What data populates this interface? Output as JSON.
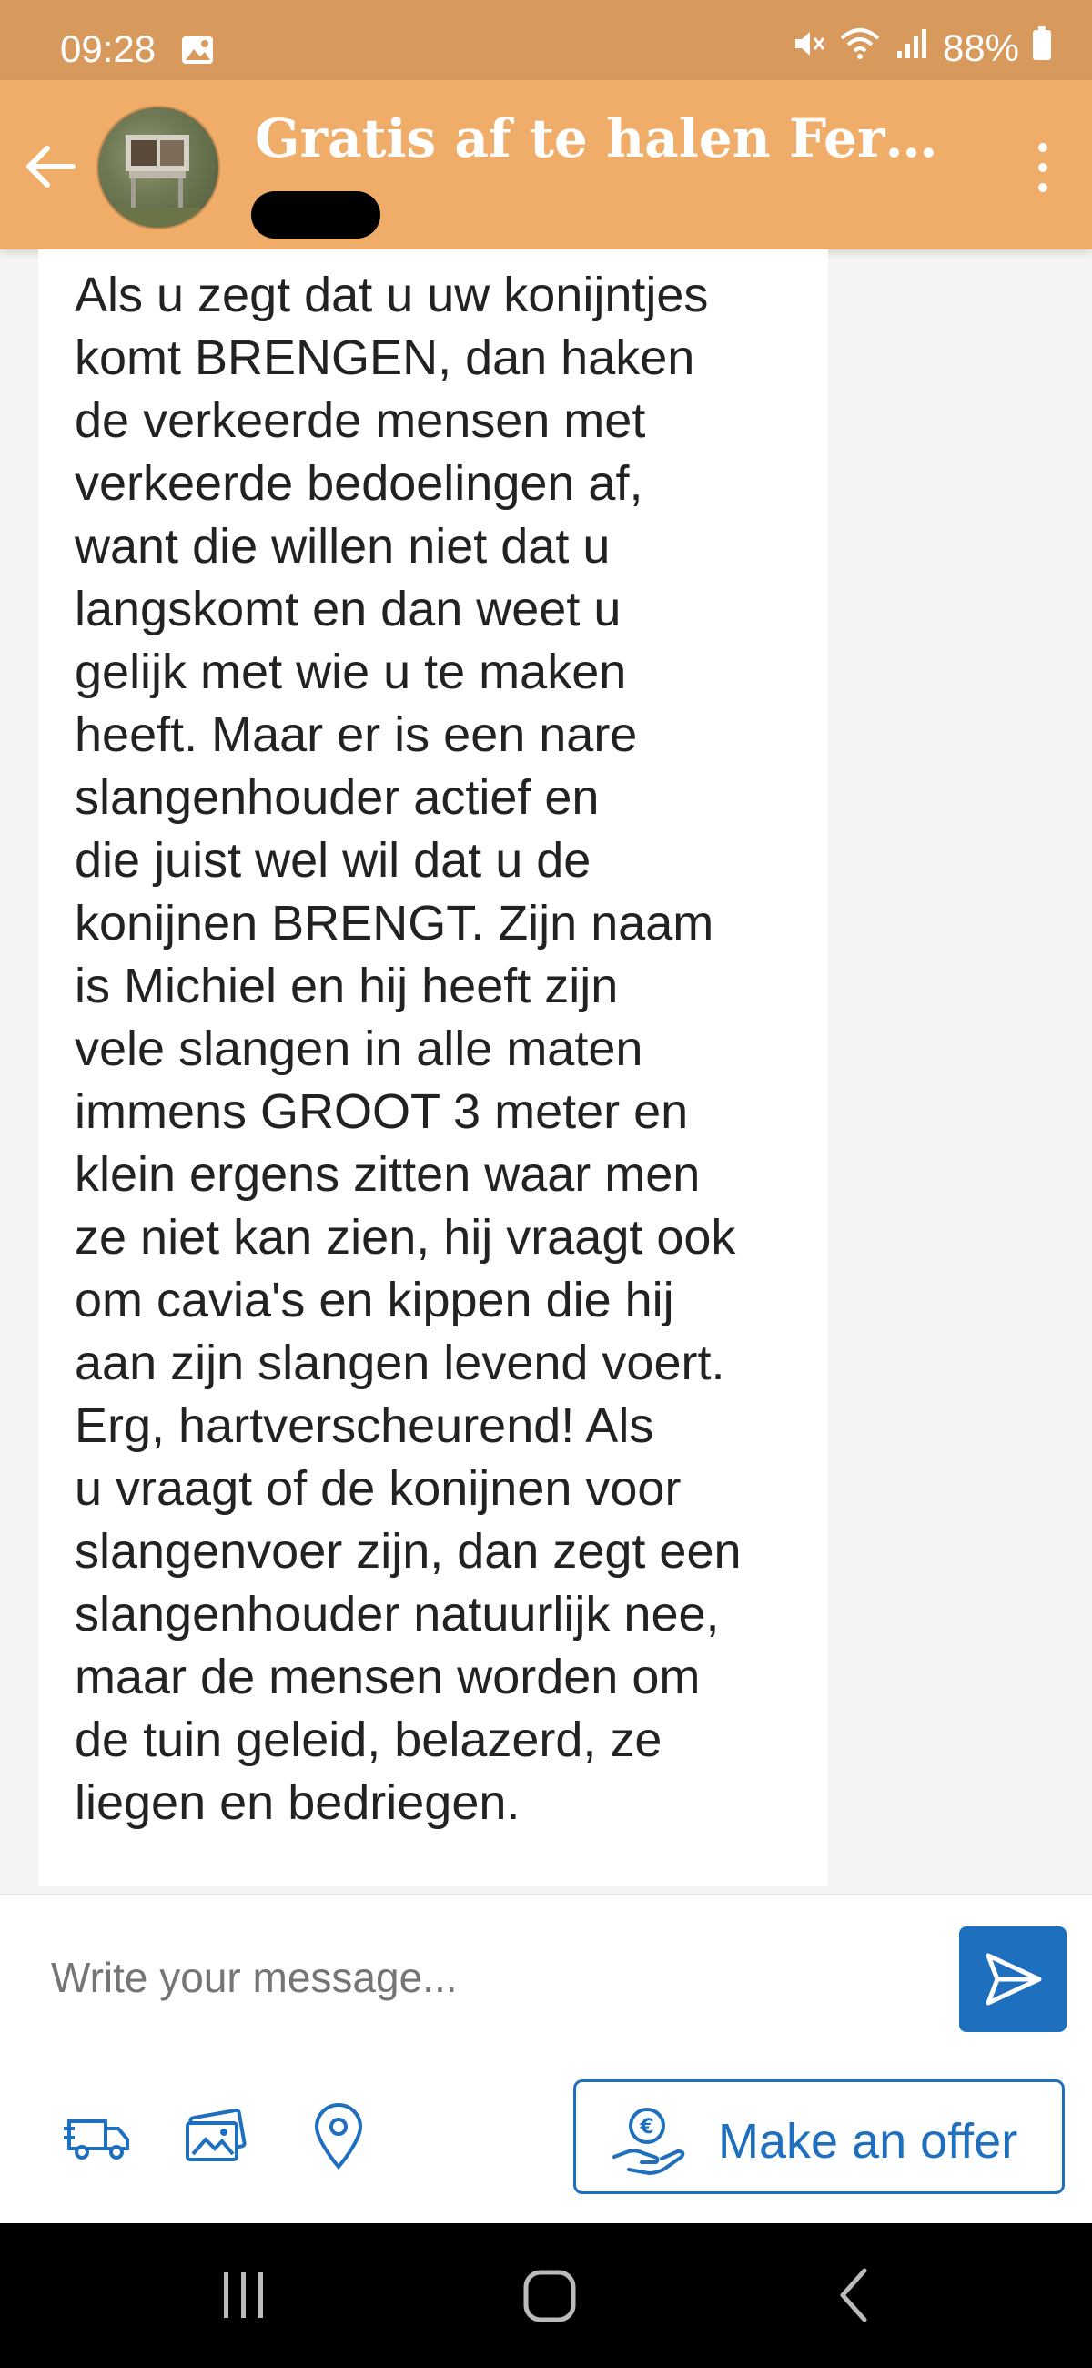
{
  "status": {
    "time": "09:28",
    "battery": "88%"
  },
  "header": {
    "title": "Gratis af te halen Ferpl..."
  },
  "message": {
    "text": "Als u zegt dat u uw konijntjes\nkomt BRENGEN, dan haken\nde verkeerde mensen met\nverkeerde bedoelingen af,\nwant die willen niet dat u\nlangskomt en dan weet u\ngelijk met wie u te maken\nheeft. Maar er is een nare\nslangenhouder actief en\ndie juist wel wil dat u de\nkonijnen BRENGT. Zijn naam\nis Michiel en hij heeft zijn\nvele slangen in alle maten\nimmens GROOT 3 meter en\nklein ergens zitten waar men\nze niet kan zien, hij vraagt ook\nom cavia's en kippen die hij\naan zijn slangen levend voert.\nErg, hartverscheurend! Als\nu vraagt of de konijnen voor\nslangenvoer zijn, dan zegt een\nslangenhouder natuurlijk nee,\nmaar de mensen worden om\nde tuin geleid, belazerd, ze\nliegen en bedriegen."
  },
  "composer": {
    "placeholder": "Write your message..."
  },
  "actions": {
    "offer_label": "Make an offer"
  },
  "colors": {
    "status_bar": "#d89a5c",
    "app_bar": "#f0ad6a",
    "accent_blue": "#1f6fbf"
  },
  "icons": [
    "image-icon",
    "mute-icon",
    "wifi-icon",
    "signal-icon",
    "battery-icon",
    "back-arrow-icon",
    "more-vert-icon",
    "send-icon",
    "delivery-truck-icon",
    "photos-icon",
    "location-pin-icon",
    "euro-hand-icon",
    "recents-icon",
    "home-icon",
    "back-icon"
  ]
}
